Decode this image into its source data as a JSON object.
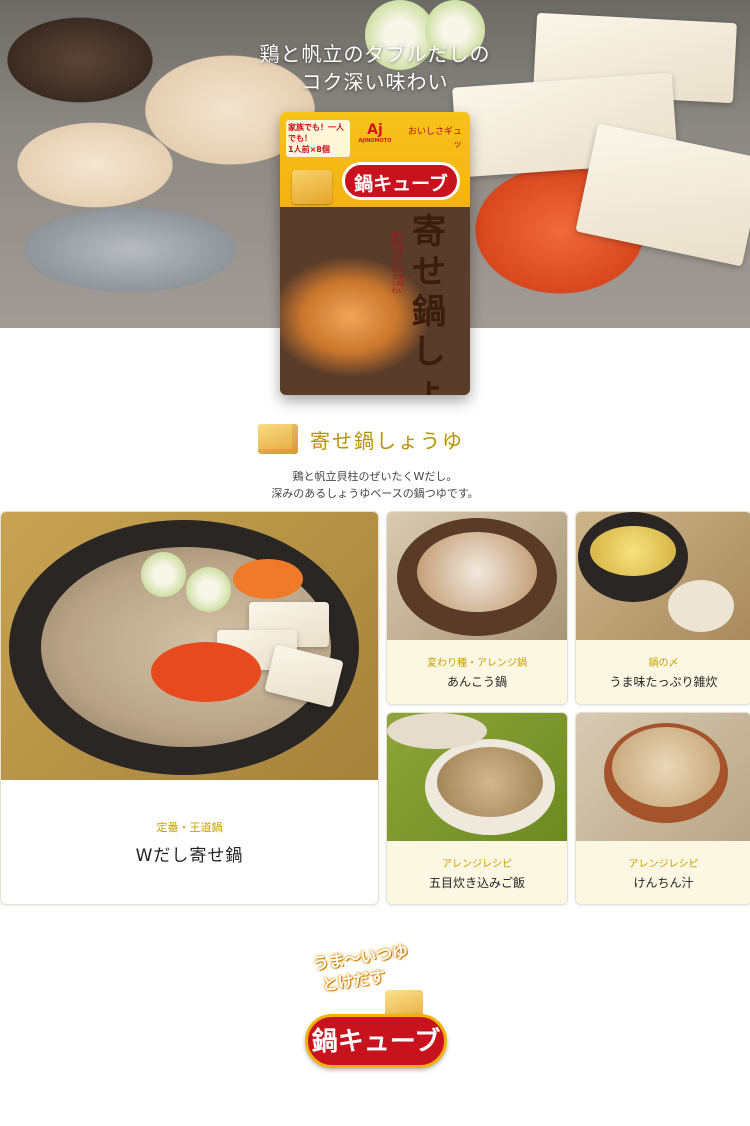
{
  "hero": {
    "copy_line1": "鶏と帆立のダブルだしの",
    "copy_line2": "コク深い味わい"
  },
  "package": {
    "brand": "Aj",
    "brand_sub": "AJINOMOTO",
    "tag_line1": "家族でも！一人でも！",
    "tag_line2": "1人前×8個",
    "cube_label": "鍋キューブ",
    "stub": "おいしさギュッ",
    "title": "寄せ鍋しょうゆ",
    "vertical_text": "鶏と帆立のダブルだしのコク深い味わい"
  },
  "section": {
    "title": "寄せ鍋しょうゆ",
    "desc_line1": "鶏と帆立貝柱のぜいたくWだし。",
    "desc_line2": "深みのあるしょうゆベースの鍋つゆです。"
  },
  "recipes": [
    {
      "category": "定番・王道鍋",
      "name": "Wだし寄せ鍋"
    },
    {
      "category": "変わり種・アレンジ鍋",
      "name": "あんこう鍋"
    },
    {
      "category": "鍋の〆",
      "name": "うま味たっぷり雑炊"
    },
    {
      "category": "アレンジレシピ",
      "name": "五目炊き込みご飯"
    },
    {
      "category": "アレンジレシピ",
      "name": "けんちん汁"
    }
  ],
  "footer_logo": {
    "catch_line1": "うま〜いつゆ",
    "catch_line2": "とけだす",
    "mark": "鍋キューブ"
  },
  "colors": {
    "accent_gold": "#c8a000",
    "brand_red": "#c8131f",
    "cream": "#fbf7e2"
  }
}
